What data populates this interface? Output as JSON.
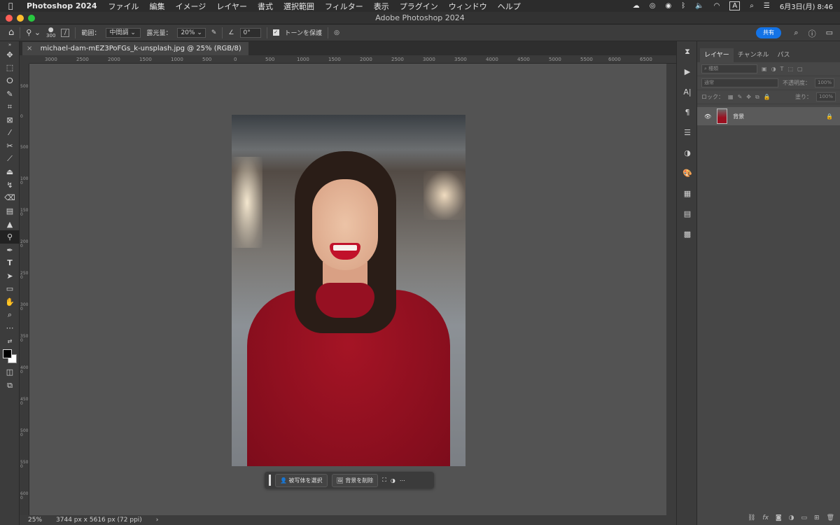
{
  "menubar": {
    "app_name": "Photoshop 2024",
    "items": [
      "ファイル",
      "編集",
      "イメージ",
      "レイヤー",
      "書式",
      "選択範囲",
      "フィルター",
      "表示",
      "プラグイン",
      "ウィンドウ",
      "ヘルプ"
    ],
    "input_indicator": "A",
    "datetime": "6月3日(月)  8:46"
  },
  "window": {
    "title": "Adobe Photoshop 2024"
  },
  "options_bar": {
    "brush_size": "300",
    "range_label": "範囲：",
    "range_value": "中間調",
    "exposure_label": "露光量：",
    "exposure_value": "20%",
    "angle_value": "0°",
    "protect_tones_label": "トーンを保護",
    "share_label": "共有"
  },
  "document": {
    "tab_title": "michael-dam-mEZ3PoFGs_k-unsplash.jpg @ 25% (RGB/8)",
    "ruler_h": [
      "3000",
      "2500",
      "2000",
      "1500",
      "1000",
      "500",
      "0",
      "500",
      "1000",
      "1500",
      "2000",
      "2500",
      "3000",
      "3500",
      "4000",
      "4500",
      "5000",
      "5500",
      "6000",
      "6500"
    ],
    "ruler_v": [
      "500",
      "0",
      "500",
      "1000",
      "1500",
      "2000",
      "2500",
      "3000",
      "3500",
      "4000",
      "4500",
      "5000",
      "5500",
      "6000"
    ]
  },
  "contextual_taskbar": {
    "select_subject": "被写体を選択",
    "remove_background": "背景を削除"
  },
  "status_bar": {
    "zoom": "25%",
    "dimensions": "3744 px x 5616 px (72 ppi)"
  },
  "layers_panel": {
    "tabs": [
      "レイヤー",
      "チャンネル",
      "パス"
    ],
    "filter_placeholder": "種類",
    "blend_mode": "通常",
    "opacity_label": "不透明度：",
    "opacity_value": "100%",
    "lock_label": "ロック：",
    "fill_label": "塗り：",
    "fill_value": "100%",
    "layers": [
      {
        "name": "背景"
      }
    ]
  },
  "colors": {
    "accent": "#1473e6",
    "canvas": "#535353",
    "panel": "#474747"
  }
}
